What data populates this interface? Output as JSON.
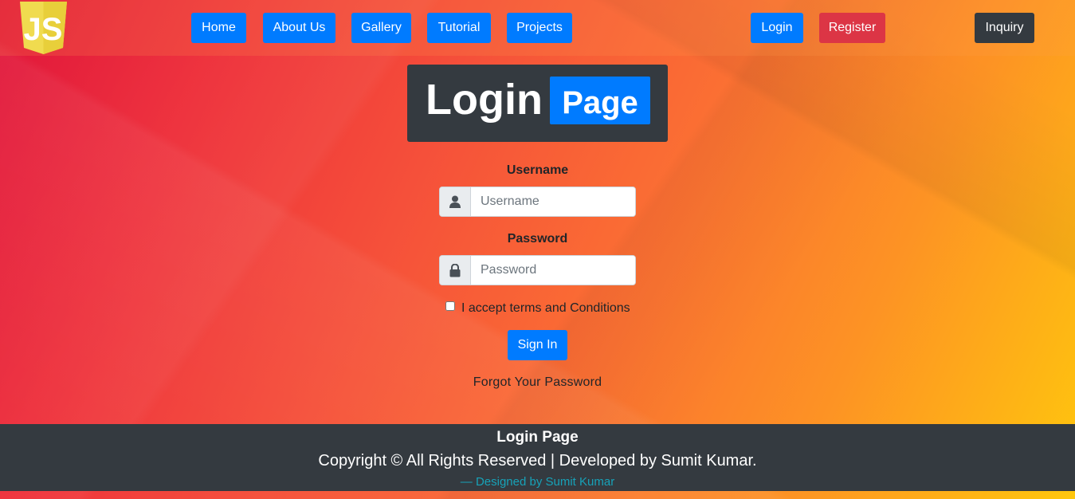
{
  "logo": {
    "icon": "js-logo-icon",
    "text": "JS",
    "color": "#f0db4f"
  },
  "nav": {
    "home": "Home",
    "about": "About Us",
    "gallery": "Gallery",
    "tutorial": "Tutorial",
    "projects": "Projects",
    "login": "Login",
    "register": "Register",
    "inquiry": "Inquiry"
  },
  "title": {
    "login": "Login",
    "page": "Page"
  },
  "form": {
    "username_label": "Username",
    "username_placeholder": "Username",
    "username_icon": "user-icon",
    "password_label": "Password",
    "password_placeholder": "Password",
    "password_icon": "lock-icon",
    "terms_label": "I accept terms and Conditions",
    "sign_in": "Sign In",
    "forgot": "Forgot Your Password"
  },
  "footer": {
    "title": "Login Page",
    "copyright": "Copyright © All Rights Reserved | Developed by Sumit Kumar.",
    "credit": "—  Designed by Sumit Kumar"
  },
  "colors": {
    "primary": "#007bff",
    "danger": "#dc3545",
    "dark": "#343a40",
    "info": "#17a2b8"
  }
}
